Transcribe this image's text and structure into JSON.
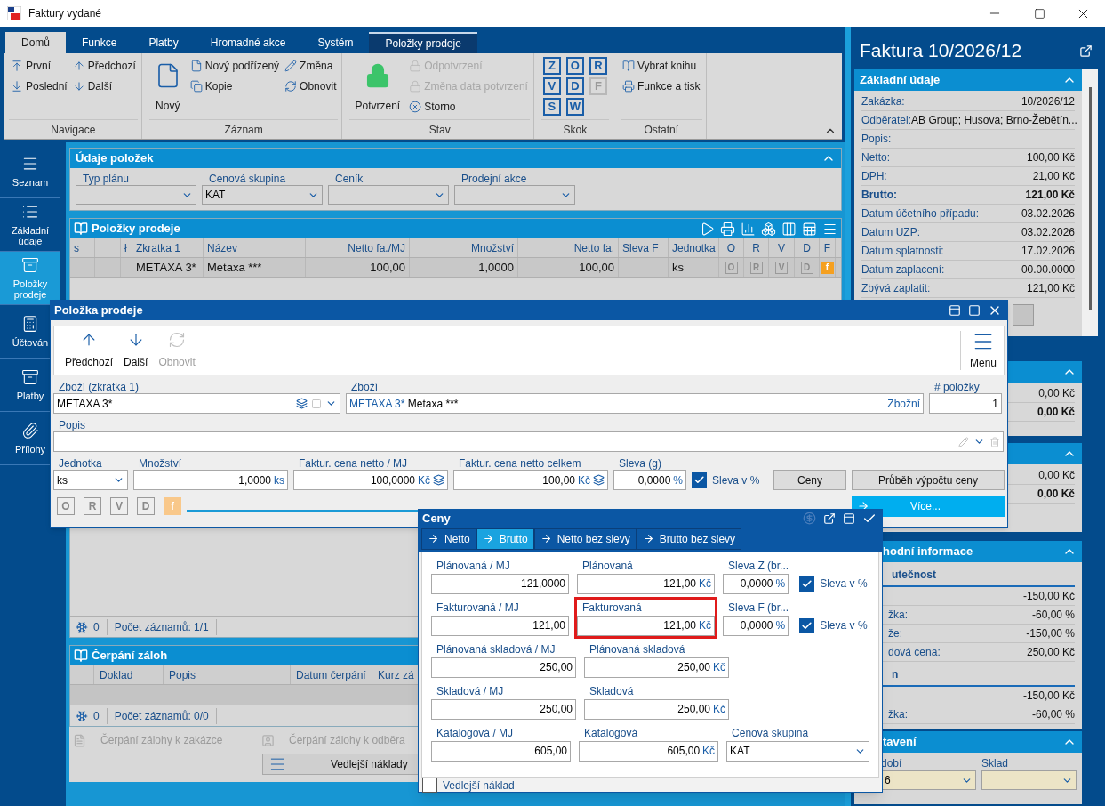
{
  "window": {
    "title": "Faktury vydané"
  },
  "ribbon": {
    "tabs": [
      {
        "label": "Domů",
        "selected": true,
        "kind": "standard"
      },
      {
        "label": "Funkce",
        "selected": false,
        "kind": "standard"
      },
      {
        "label": "Platby",
        "selected": false,
        "kind": "standard"
      },
      {
        "label": "Hromadné akce",
        "selected": false,
        "kind": "standard"
      },
      {
        "label": "Systém",
        "selected": false,
        "kind": "standard"
      },
      {
        "label": "Položky prodeje",
        "selected": false,
        "kind": "context"
      }
    ],
    "groups": [
      {
        "label": "Navigace",
        "columns": [
          [
            {
              "label": "První",
              "kind": "small",
              "disabled": false
            },
            {
              "label": "Poslední",
              "kind": "small",
              "disabled": false
            }
          ],
          [
            {
              "label": "Předchozí",
              "kind": "small",
              "disabled": false
            },
            {
              "label": "Další",
              "kind": "small",
              "disabled": false
            }
          ]
        ]
      },
      {
        "label": "Záznam",
        "columns": [
          [
            {
              "label": "Nový",
              "kind": "large",
              "disabled": false
            }
          ],
          [
            {
              "label": "Nový podřízený",
              "kind": "small",
              "disabled": false
            },
            {
              "label": "Kopie",
              "kind": "small",
              "disabled": false
            }
          ],
          [
            {
              "label": "Změna",
              "kind": "small",
              "disabled": false
            },
            {
              "label": "Obnovit",
              "kind": "small",
              "disabled": false
            }
          ]
        ]
      },
      {
        "label": "Stav",
        "columns": [
          [
            {
              "label": "Potvrzení",
              "kind": "large",
              "disabled": false
            }
          ],
          [
            {
              "label": "Odpotvrzení",
              "kind": "small",
              "disabled": true
            },
            {
              "label": "Změna data potvrzení",
              "kind": "small",
              "disabled": true
            },
            {
              "label": "Storno",
              "kind": "small",
              "disabled": false
            }
          ]
        ]
      },
      {
        "label": "Skok",
        "columns": [
          [
            {
              "label": "Z",
              "kind": "key",
              "disabled": false
            },
            {
              "label": "V",
              "kind": "key",
              "disabled": false
            },
            {
              "label": "S",
              "kind": "key",
              "disabled": false
            }
          ],
          [
            {
              "label": "O",
              "kind": "key",
              "disabled": false
            },
            {
              "label": "D",
              "kind": "key",
              "disabled": false
            },
            {
              "label": "W",
              "kind": "key",
              "disabled": false
            }
          ],
          [
            {
              "label": "R",
              "kind": "key",
              "disabled": false
            },
            {
              "label": "F",
              "kind": "key",
              "disabled": true
            }
          ]
        ]
      },
      {
        "label": "Ostatní",
        "columns": [
          [
            {
              "label": "Vybrat knihu",
              "kind": "small",
              "disabled": false
            },
            {
              "label": "Funkce a tisk",
              "kind": "small",
              "disabled": false
            }
          ]
        ]
      }
    ]
  },
  "sidebar": {
    "items": [
      {
        "label": "Seznam",
        "selected": false
      },
      {
        "label": "Základní údaje",
        "selected": false
      },
      {
        "label": "Položky prodeje",
        "selected": true
      },
      {
        "label": "Účtován",
        "selected": false
      },
      {
        "label": "Platby",
        "selected": false
      },
      {
        "label": "Přílohy",
        "selected": false
      }
    ]
  },
  "item_data": {
    "title": "Údaje položek",
    "fields": [
      {
        "label": "Typ plánu"
      },
      {
        "label": "Cenová skupina",
        "value": "KAT"
      },
      {
        "label": "Ceník"
      },
      {
        "label": "Prodejní akce"
      }
    ]
  },
  "items_grid": {
    "title": "Položky prodeje",
    "columns": [
      {
        "label": "s"
      },
      {},
      {
        "label": "ł"
      },
      {
        "label": "Zkratka 1"
      },
      {
        "label": "Název"
      },
      {
        "label": "Netto fa./MJ"
      },
      {
        "label": "Množství"
      },
      {
        "label": "Netto fa."
      },
      {
        "label": "Sleva F"
      },
      {
        "label": "Jednotka"
      },
      {
        "label": "O"
      },
      {
        "label": "R"
      },
      {
        "label": "V"
      },
      {
        "label": "D"
      },
      {
        "label": "F"
      }
    ],
    "rows": [
      {
        "cells": [
          null,
          null,
          null,
          "METAXA 3*",
          "Metaxa ***",
          "100,00",
          "1,0000",
          "100,00",
          null,
          "ks"
        ],
        "flags": [
          {
            "label": "O",
            "on": false
          },
          {
            "label": "R",
            "on": false
          },
          {
            "label": "V",
            "on": false
          },
          {
            "label": "D",
            "on": false
          },
          {
            "label": "f",
            "on": true
          }
        ]
      }
    ],
    "status": {
      "count": "0",
      "text": "Počet záznamů: 1/1"
    }
  },
  "advances_grid": {
    "title": "Čerpání záloh",
    "columns": [
      "Doklad",
      "Popis",
      "Datum čerpání",
      "Kurz zá"
    ],
    "status": {
      "count": "0",
      "text": "Počet záznamů: 0/0"
    }
  },
  "bottom_actions": [
    {
      "label": "Čerpání zálohy k zakázce",
      "disabled": true
    },
    {
      "label": "Čerpání zálohy k odběra",
      "disabled": true
    }
  ],
  "side_costs_button": {
    "label": "Vedlejší náklady"
  },
  "invoice_panel": {
    "title": "Faktura 10/2026/12",
    "sections": [
      {
        "kind": "rows",
        "title": "Základní údaje",
        "rows": [
          {
            "label": "Zakázka:",
            "value": "10/2026/12",
            "bold": false
          },
          {
            "label": "Odběratel:",
            "value": "AB Group; Husova; Brno-Žebětín...",
            "bold": false
          },
          {
            "label": "Popis:",
            "bold": false
          },
          {
            "label": "Netto:",
            "value": "100,00 Kč",
            "bold": false
          },
          {
            "label": "DPH:",
            "value": "21,00 Kč",
            "bold": false
          },
          {
            "label": "Brutto:",
            "value": "121,00 Kč",
            "bold": true
          },
          {
            "label": "Datum účetního případu:",
            "value": "03.02.2026",
            "bold": false
          },
          {
            "label": "Datum UZP:",
            "value": "03.02.2026",
            "bold": false
          },
          {
            "label": "Datum splatnosti:",
            "value": "17.02.2026",
            "bold": false
          },
          {
            "label": "Datum zaplacení:",
            "value": "00.00.0000",
            "bold": false
          },
          {
            "label": "Zbývá zaplatit:",
            "value": "121,00 Kč",
            "bold": false
          }
        ]
      },
      {
        "kind": "rows",
        "rows": [
          {
            "value": "0,00 Kč",
            "bold": false
          },
          {
            "value": "0,00 Kč",
            "bold": true
          }
        ]
      },
      {
        "kind": "rows",
        "rows": [
          {
            "value": "0,00 Kč",
            "bold": false
          },
          {
            "value": "0,00 Kč",
            "bold": true
          }
        ]
      },
      {
        "kind": "groups",
        "title": "hodní informace",
        "groups": [
          {
            "heading": "utečnost",
            "rows": [
              {
                "value": "-150,00 Kč",
                "bold": false
              },
              {
                "label": "žka:",
                "value": "-60,00 %",
                "bold": false
              },
              {
                "label": "že:",
                "value": "-150,00 %",
                "bold": false
              },
              {
                "label": "dová cena:",
                "value": "250,00 Kč",
                "bold": false
              }
            ]
          },
          {
            "heading": "n",
            "rows": [
              {
                "value": "-150,00 Kč",
                "bold": false
              },
              {
                "label": "žka:",
                "value": "-60,00 %",
                "bold": false
              }
            ]
          }
        ]
      },
      {
        "kind": "fields",
        "title": "tavení",
        "fields": [
          {
            "label": "dobí",
            "value": "6"
          },
          {
            "label": "Sklad"
          }
        ]
      }
    ]
  },
  "item_dialog": {
    "title": "Položka prodeje",
    "toolbar": [
      {
        "label": "Předchozí",
        "disabled": false
      },
      {
        "label": "Další",
        "disabled": false
      },
      {
        "label": "Obnovit",
        "disabled": true
      }
    ],
    "menu_label": "Menu",
    "fields": [
      {
        "kind": "combo",
        "label": "Zboží (zkratka 1)",
        "value": "METAXA 3*"
      },
      {
        "kind": "goods",
        "label": "Zboží",
        "code": "METAXA 3*",
        "value": "Metaxa ***",
        "note": "Zbožní"
      },
      {
        "kind": "number",
        "label": "# položky",
        "value": "1"
      },
      {
        "kind": "memo",
        "label": "Popis"
      },
      {
        "kind": "select",
        "label": "Jednotka",
        "value": "ks"
      },
      {
        "kind": "amount",
        "label": "Množství",
        "value": "1,0000",
        "unit": "ks",
        "calc_button": false
      },
      {
        "kind": "amount",
        "label": "Faktur. cena netto / MJ",
        "value": "100,0000",
        "unit": "Kč",
        "calc_button": true
      },
      {
        "kind": "amount",
        "label": "Faktur. cena netto celkem",
        "value": "100,00",
        "unit": "Kč",
        "calc_button": true
      },
      {
        "kind": "amount",
        "label": "Sleva (g)",
        "value": "0,0000",
        "unit": "%",
        "calc_button": false
      },
      {
        "kind": "checkbox",
        "label": "Sleva v %",
        "checked": true
      },
      {
        "kind": "button",
        "label": "Ceny"
      },
      {
        "kind": "button",
        "label": "Průběh výpočtu ceny"
      }
    ],
    "flags": [
      {
        "label": "O",
        "on": false
      },
      {
        "label": "R",
        "on": false
      },
      {
        "label": "V",
        "on": false
      },
      {
        "label": "D",
        "on": false
      },
      {
        "label": "f",
        "on": true
      }
    ],
    "more_button": {
      "label": "Více..."
    }
  },
  "price_dialog": {
    "title": "Ceny",
    "tabs": [
      {
        "label": "Netto",
        "selected": false
      },
      {
        "label": "Brutto",
        "selected": true
      },
      {
        "label": "Netto bez slevy",
        "selected": false
      },
      {
        "label": "Brutto bez slevy",
        "selected": false
      }
    ],
    "rows": [
      [
        {
          "kind": "amount",
          "label": "Plánovaná / MJ",
          "value": "121,0000",
          "highlighted": false
        },
        {
          "kind": "amount",
          "label": "Plánovaná",
          "value": "121,00",
          "unit": "Kč",
          "highlighted": false
        },
        {
          "kind": "amount",
          "label": "Sleva Z (br...",
          "value": "0,0000",
          "unit": "%",
          "highlighted": false
        },
        {
          "kind": "checkbox",
          "label": "Sleva v %",
          "checked": true
        }
      ],
      [
        {
          "kind": "amount",
          "label": "Fakturovaná / MJ",
          "value": "121,00",
          "highlighted": false
        },
        {
          "kind": "amount",
          "label": "Fakturovaná",
          "value": "121,00",
          "unit": "Kč",
          "highlighted": true
        },
        {
          "kind": "amount",
          "label": "Sleva F (br...",
          "value": "0,0000",
          "unit": "%",
          "highlighted": false
        },
        {
          "kind": "checkbox",
          "label": "Sleva v %",
          "checked": true
        }
      ],
      [
        {
          "kind": "amount",
          "label": "Plánovaná skladová / MJ",
          "value": "250,00",
          "highlighted": false
        },
        {
          "kind": "amount",
          "label": "Plánovaná skladová",
          "value": "250,00",
          "unit": "Kč",
          "highlighted": false
        }
      ],
      [
        {
          "kind": "amount",
          "label": "Skladová / MJ",
          "value": "250,00",
          "highlighted": false
        },
        {
          "kind": "amount",
          "label": "Skladová",
          "value": "250,00",
          "unit": "Kč",
          "highlighted": false
        }
      ],
      [
        {
          "kind": "amount",
          "label": "Katalogová / MJ",
          "value": "605,00",
          "highlighted": false
        },
        {
          "kind": "amount",
          "label": "Katalogová",
          "value": "605,00",
          "unit": "Kč",
          "highlighted": false
        },
        {
          "kind": "select",
          "label": "Cenová skupina",
          "value": "KAT"
        }
      ]
    ],
    "extra_cost": {
      "label": "Vedlejší náklad",
      "checked": false
    }
  }
}
